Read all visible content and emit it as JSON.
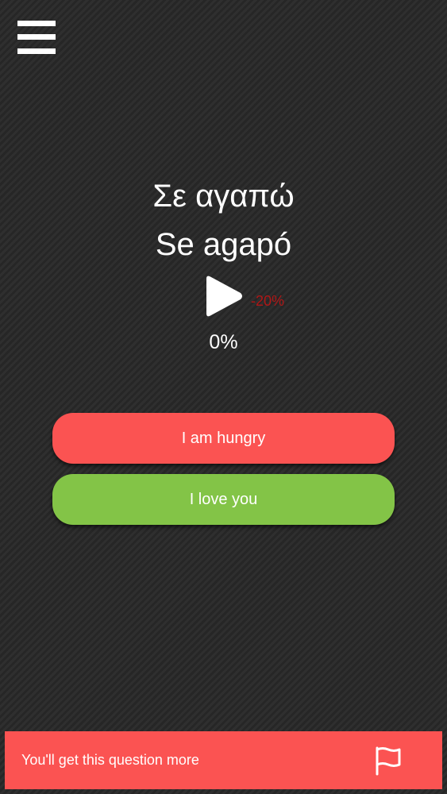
{
  "header": {
    "menu_icon": "hamburger-menu-icon"
  },
  "phrase": {
    "native": "Σε αγαπώ",
    "transliteration": "Se agapó"
  },
  "audio": {
    "play_icon": "play-icon",
    "speed": "-20%"
  },
  "progress": {
    "label": "0%"
  },
  "answers": [
    {
      "label": "I am hungry",
      "color": "#fb5352"
    },
    {
      "label": "I love you",
      "color": "#83c447"
    }
  ],
  "feedback": {
    "message": "You'll get this question more",
    "flag_icon": "flag-icon"
  },
  "colors": {
    "background": "#2b2b2b",
    "wrong": "#fb5352",
    "correct": "#83c447",
    "speed_text": "#b01616"
  }
}
